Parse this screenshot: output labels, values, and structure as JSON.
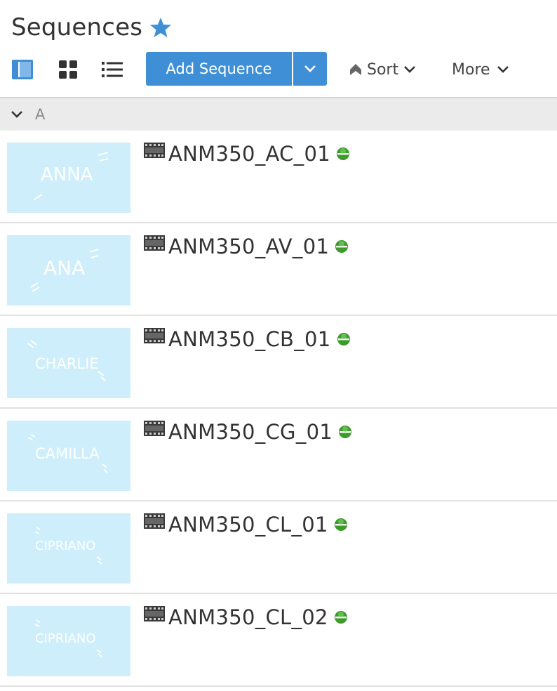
{
  "header": {
    "title": "Sequences",
    "star_color": "#3f8fd6"
  },
  "toolbar": {
    "add_label": "Add Sequence",
    "sort_label": "Sort",
    "more_label": "More",
    "accent": "#3f8fd6"
  },
  "group": {
    "label": "A"
  },
  "sequences": [
    {
      "name": "ANM350_AC_01",
      "thumb_text": "ANNA",
      "status": "green"
    },
    {
      "name": "ANM350_AV_01",
      "thumb_text": "ANA",
      "status": "green"
    },
    {
      "name": "ANM350_CB_01",
      "thumb_text": "CHARLIE",
      "status": "green"
    },
    {
      "name": "ANM350_CG_01",
      "thumb_text": "CAMILLA",
      "status": "green"
    },
    {
      "name": "ANM350_CL_01",
      "thumb_text": "CIPRIANO",
      "status": "green"
    },
    {
      "name": "ANM350_CL_02",
      "thumb_text": "CIPRIANO",
      "status": "green"
    }
  ]
}
